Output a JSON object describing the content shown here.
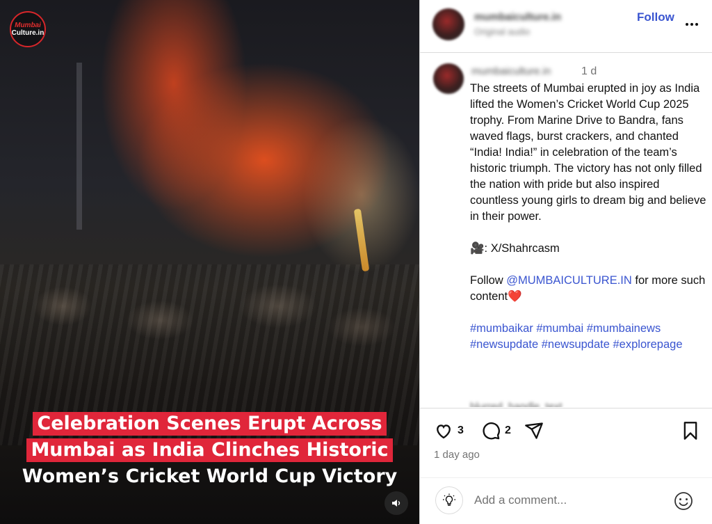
{
  "media": {
    "logo_line1": "Mumbai",
    "logo_line2": "Culture.in",
    "caption": [
      "Celebration Scenes Erupt Across",
      "Mumbai as India Clinches Historic",
      "Women’s Cricket World Cup Victory"
    ],
    "mute_icon": "speaker-icon"
  },
  "header": {
    "username": "mumbaiculture.in",
    "audio": "Original audio",
    "follow_label": "Follow",
    "more_icon": "more-dots-icon"
  },
  "post": {
    "username": "mumbaiculture.in",
    "time": "1 d",
    "paragraph": "The streets of Mumbai erupted in joy as India lifted the Women’s Cricket World Cup 2025 trophy. From Marine Drive to Bandra, fans waved flags, burst crackers, and chanted “India! India!” in celebration of the team’s historic triumph. The victory has not only filled the nation with pride but also inspired countless young girls to dream big and believe in their power.",
    "credit": "🎥: X/Shahrcasm",
    "follow_prefix": "Follow ",
    "mention": "@MUMBAICULTURE.IN",
    "follow_suffix": " for more such content❤️",
    "hashtags": "#mumbaikar #mumbai #mumbainews #newsupdate #newsupdate #explorepage",
    "next_comment": "blurred_handle_text"
  },
  "actions": {
    "likes": "3",
    "comments": "2",
    "date": "1 day ago"
  },
  "comment_bar": {
    "placeholder": "Add a comment..."
  },
  "colors": {
    "accent": "#3a55d0",
    "caption_highlight": "#e0263a",
    "logo_red": "#d7262a"
  }
}
